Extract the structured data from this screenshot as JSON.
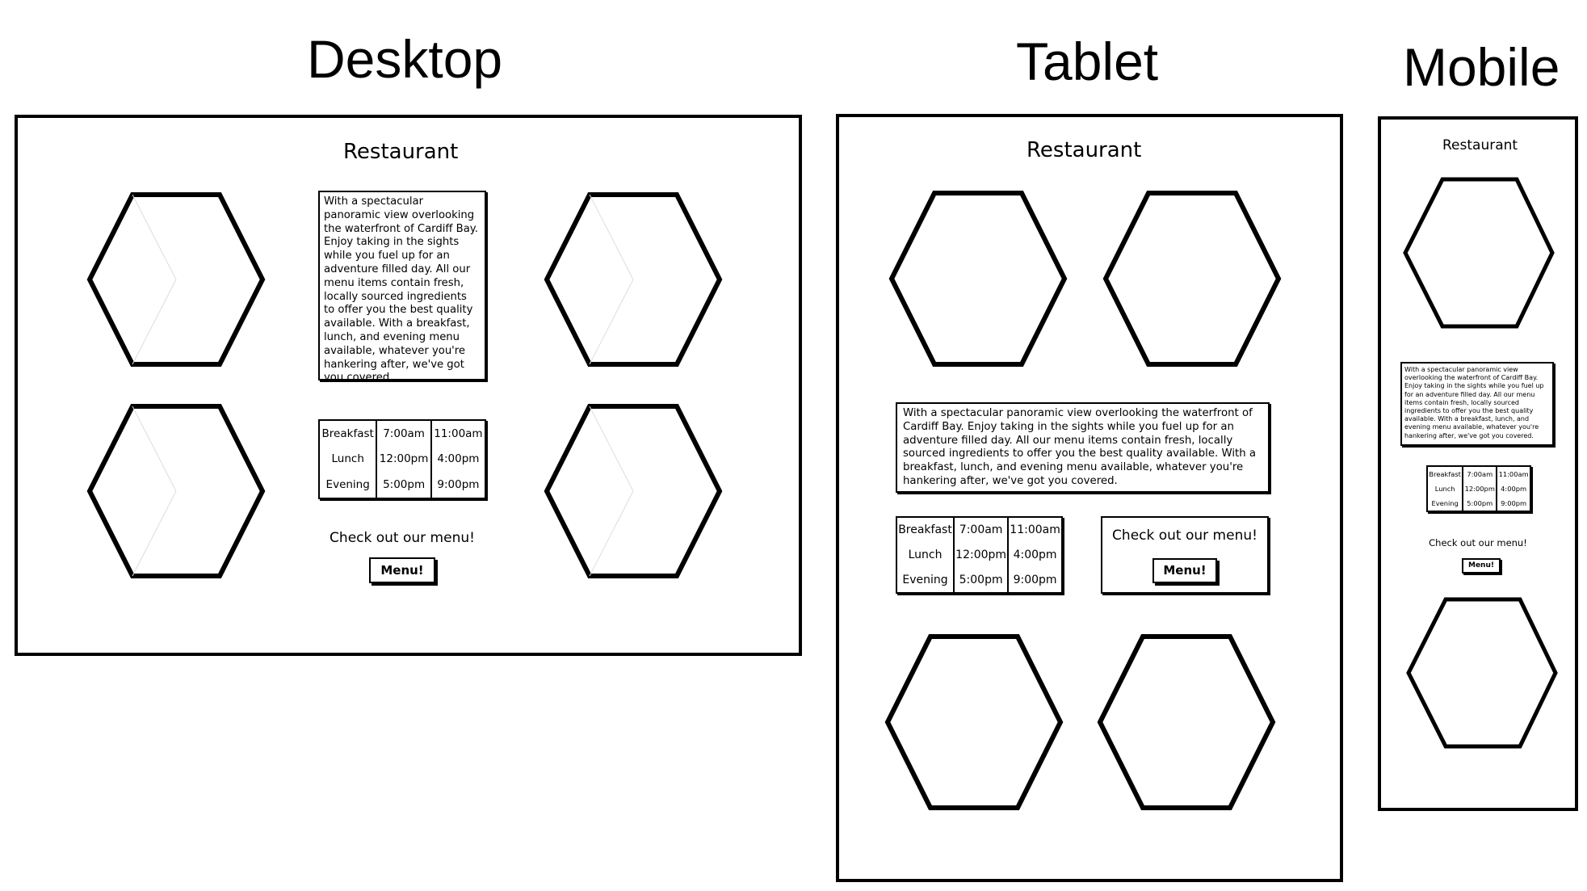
{
  "headings": {
    "desktop": "Desktop",
    "tablet": "Tablet",
    "mobile": "Mobile"
  },
  "site": {
    "title": "Restaurant",
    "description": "With a spectacular panoramic view overlooking the waterfront of Cardiff Bay. Enjoy taking in the sights while you fuel up for an adventure filled day. All our menu items contain fresh, locally sourced ingredients to offer you the best quality available. With a breakfast, lunch, and evening menu available, whatever you're hankering after, we've got you covered.",
    "hours": [
      {
        "meal": "Breakfast",
        "open": "7:00am",
        "close": "11:00am"
      },
      {
        "meal": "Lunch",
        "open": "12:00pm",
        "close": "4:00pm"
      },
      {
        "meal": "Evening",
        "open": "5:00pm",
        "close": "9:00pm"
      }
    ],
    "cta_text": "Check out our menu!",
    "menu_button_label": "Menu!"
  },
  "icons": {
    "hexagon": "hexagon-image-placeholder"
  },
  "colors": {
    "stroke": "#000000",
    "background": "#ffffff"
  }
}
